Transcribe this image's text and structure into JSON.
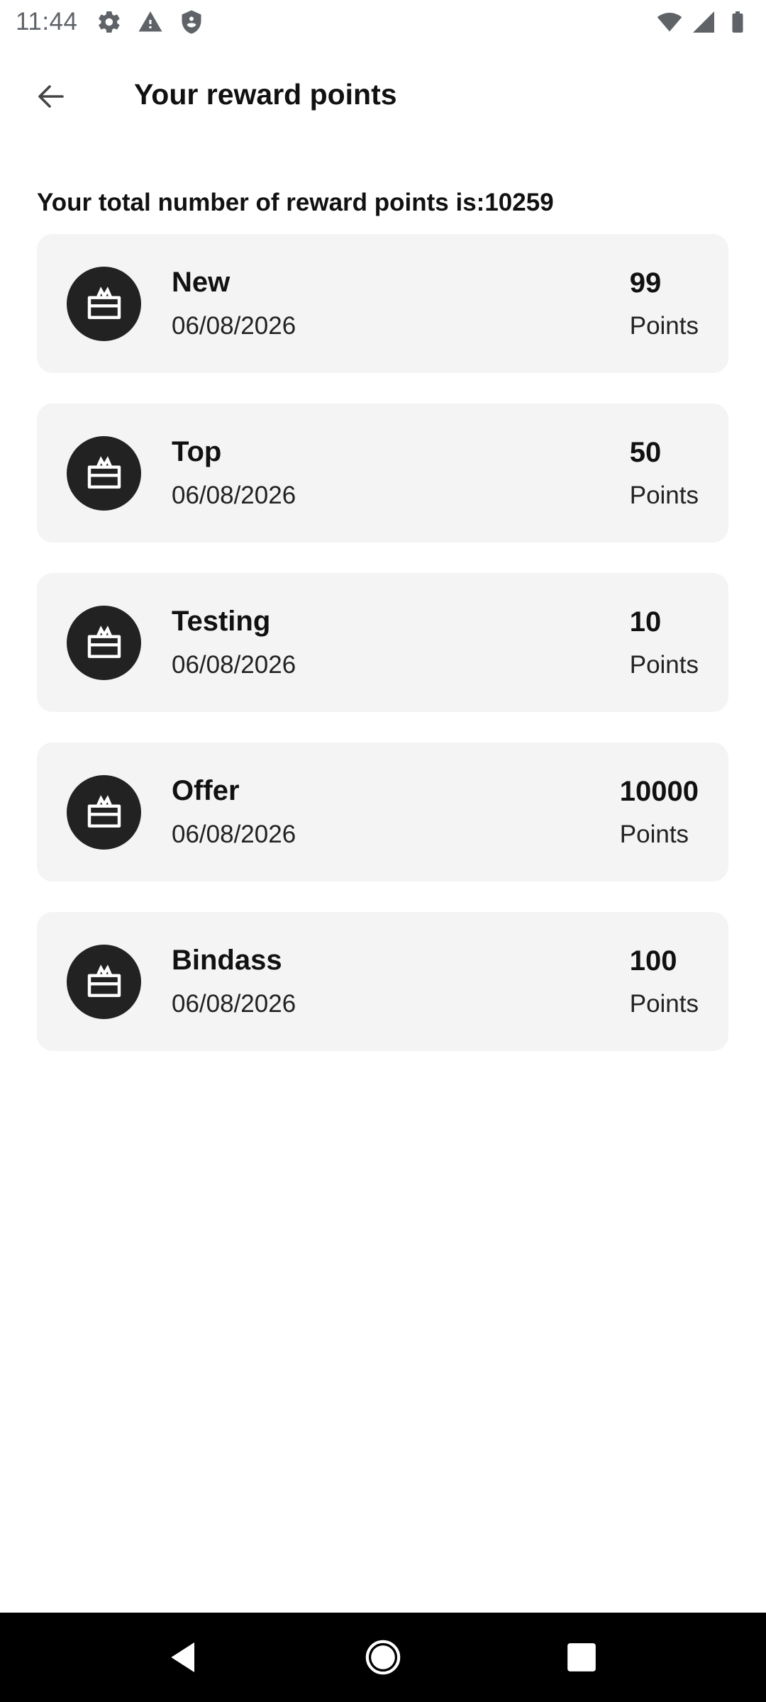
{
  "status_bar": {
    "time": "11:44",
    "left_icons": [
      "settings-icon",
      "warning-icon",
      "shield-icon"
    ],
    "right_icons": [
      "wifi-icon",
      "cellular-icon",
      "battery-icon"
    ]
  },
  "app_bar": {
    "title": "Your reward points",
    "back_icon": "arrow-back-icon"
  },
  "summary": {
    "total_text": "Your total number of reward points is:10259"
  },
  "rewards": [
    {
      "name": "New",
      "date": "06/08/2026",
      "points": "99",
      "unit": "Points",
      "icon": "gift-card-icon"
    },
    {
      "name": "Top",
      "date": "06/08/2026",
      "points": "50",
      "unit": "Points",
      "icon": "gift-card-icon"
    },
    {
      "name": "Testing",
      "date": "06/08/2026",
      "points": "10",
      "unit": "Points",
      "icon": "gift-card-icon"
    },
    {
      "name": "Offer",
      "date": "06/08/2026",
      "points": "10000",
      "unit": "Points",
      "icon": "gift-card-icon"
    },
    {
      "name": "Bindass",
      "date": "06/08/2026",
      "points": "100",
      "unit": "Points",
      "icon": "gift-card-icon"
    }
  ],
  "nav_bar": {
    "buttons": [
      "nav-back-icon",
      "nav-home-icon",
      "nav-recents-icon"
    ]
  },
  "colors": {
    "card_background": "#f4f4f4",
    "icon_circle": "#222222",
    "text_primary": "#111111",
    "status_icons": "#5f6368",
    "nav_bar": "#000000"
  }
}
